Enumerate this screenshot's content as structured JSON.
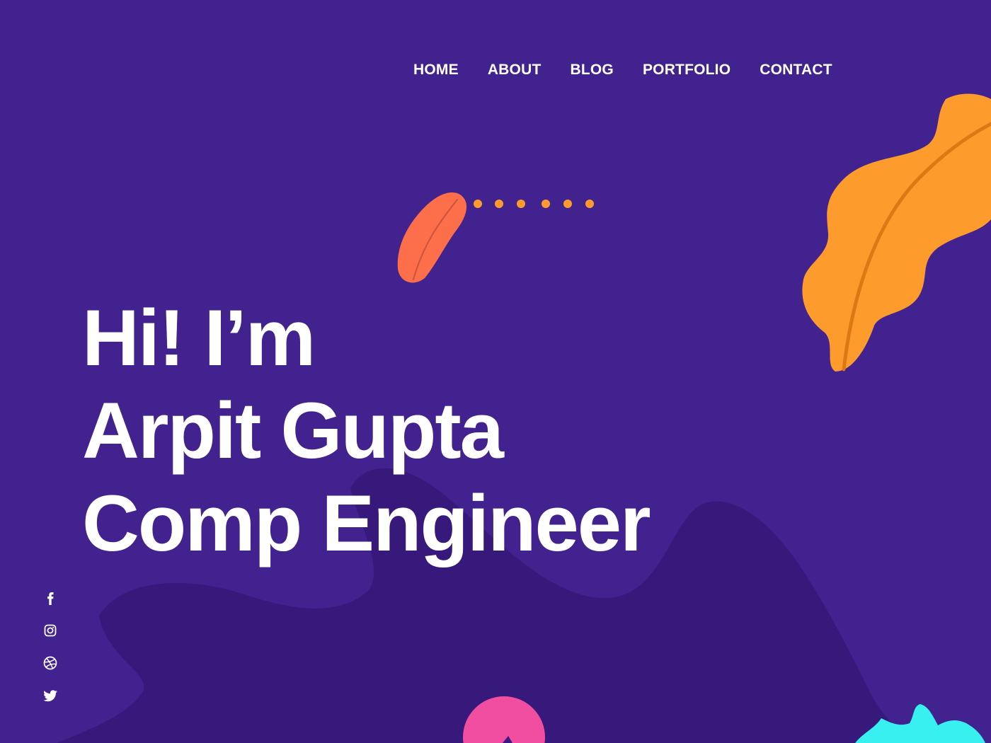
{
  "nav": {
    "home": "HOME",
    "about": "ABOUT",
    "blog": "BLOG",
    "portfolio": "PORTFOLIO",
    "contact": "CONTACT"
  },
  "hero": {
    "line1": "Hi! I’m",
    "line2": "Arpit Gupta",
    "line3": "Comp Engineer"
  },
  "social": [
    "facebook-icon",
    "instagram-icon",
    "dribbble-icon",
    "twitter-icon"
  ],
  "colors": {
    "background": "#41228e",
    "background_shape": "#36197b",
    "leaf_orange": "#fd9c2c",
    "leaf_vein": "#db7a14",
    "leaf_red": "#fd6e4b",
    "dots": "#fd9c2c",
    "circle_pink": "#f14ea2",
    "splash_cyan": "#39f0f0",
    "text": "#ffffff"
  }
}
